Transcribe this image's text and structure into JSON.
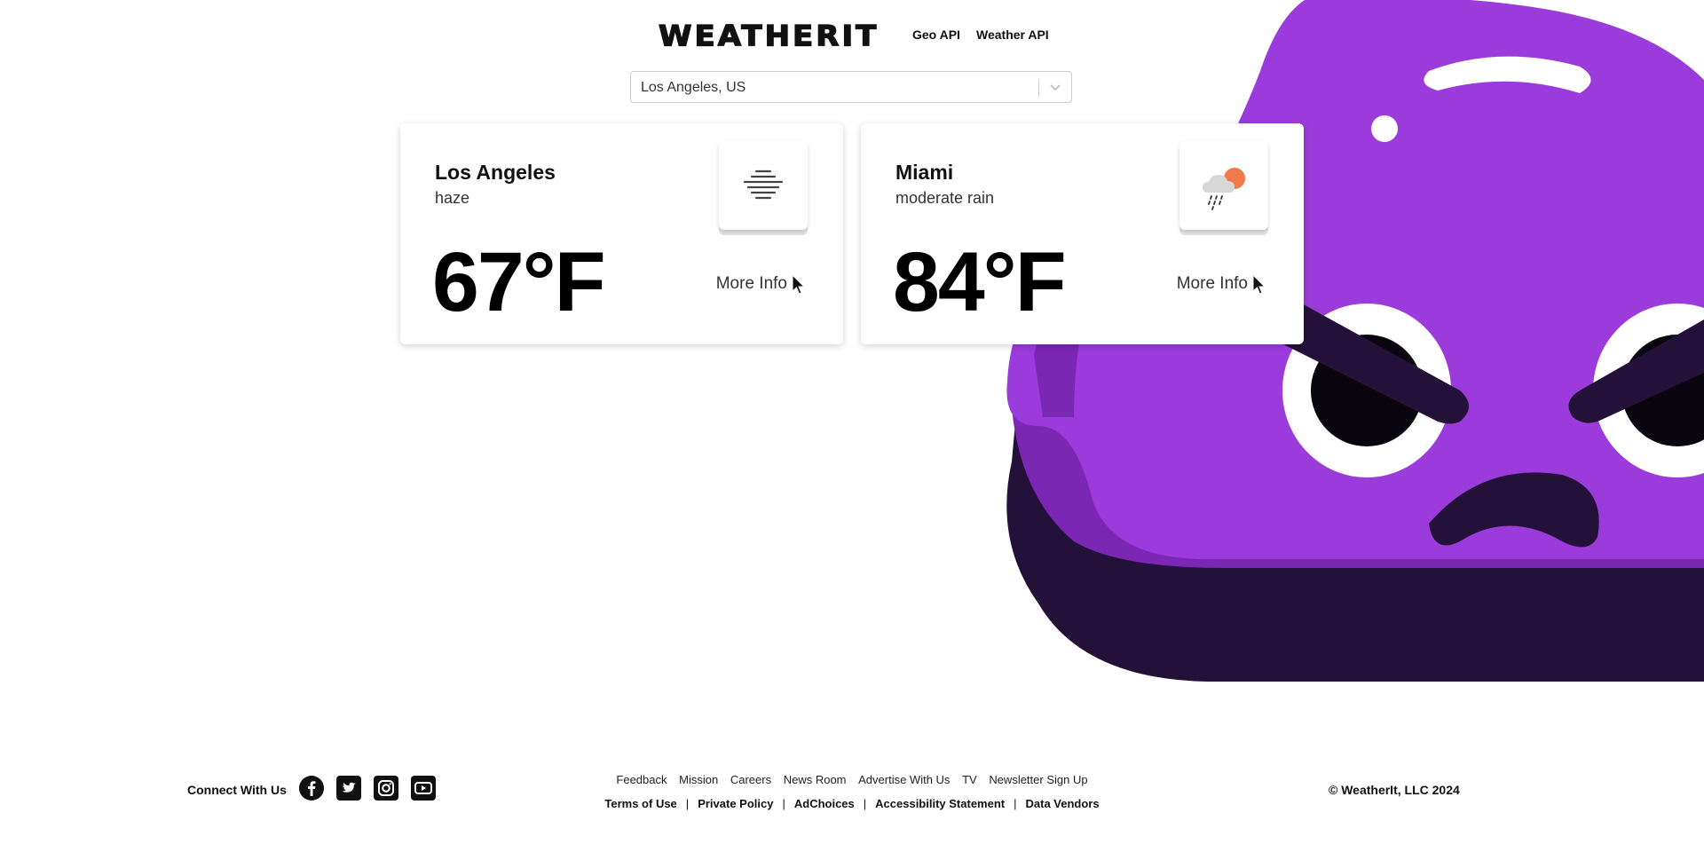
{
  "header": {
    "logo": "WEATHERIT",
    "nav": [
      {
        "label": "Geo API"
      },
      {
        "label": "Weather API"
      }
    ]
  },
  "search": {
    "selected_city": "Los Angeles, US",
    "arrow_icon": "chevron-down-icon"
  },
  "cards": [
    {
      "city": "Los Angeles",
      "description": "haze",
      "temperature": "67°F",
      "icon": "haze-icon",
      "more_info": "More Info"
    },
    {
      "city": "Miami",
      "description": "moderate rain",
      "temperature": "84°F",
      "icon": "rain-sun-cloud-icon",
      "more_info": "More Info"
    }
  ],
  "footer": {
    "connect_label": "Connect With Us",
    "social": [
      "facebook-icon",
      "twitter-icon",
      "instagram-icon",
      "youtube-icon"
    ],
    "links_top": [
      "Feedback",
      "Mission",
      "Careers",
      "News Room",
      "Advertise With Us",
      "TV",
      "Newsletter Sign Up"
    ],
    "links_bottom": [
      "Terms of Use",
      "Private Policy",
      "AdChoices",
      "Accessibility Statement",
      "Data Vendors"
    ],
    "copyright": "© WeatherIt, LLC 2024"
  },
  "colors": {
    "mascot_purple": "#9b3bdb",
    "mascot_mid": "#7a27b4",
    "mascot_dark": "#23113a",
    "sun_orange": "#f07a4a"
  }
}
